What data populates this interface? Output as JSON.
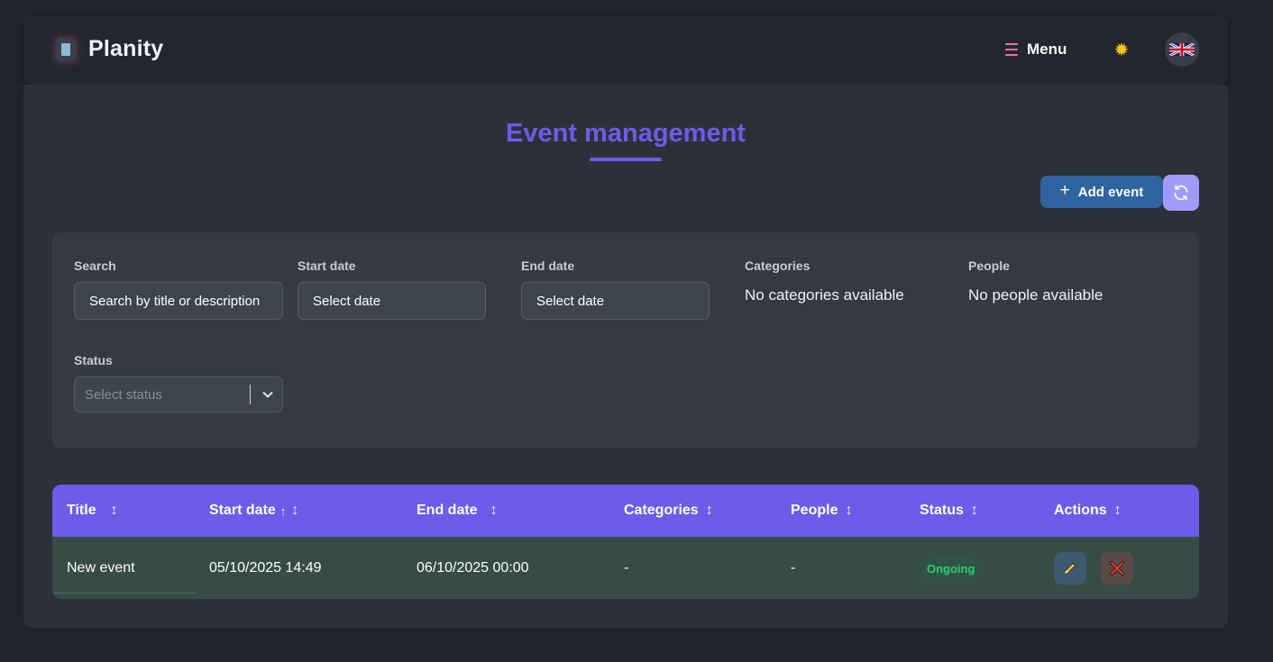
{
  "brand": {
    "name": "Planity"
  },
  "nav": {
    "menu_label": "Menu",
    "theme_icon": "sun-icon",
    "language_icon": "uk-flag-icon"
  },
  "page": {
    "title": "Event management"
  },
  "toolbar": {
    "add_label": "Add event",
    "add_icon": "plus-icon",
    "refresh_icon": "refresh-icon"
  },
  "filters": {
    "search_label": "Search",
    "search_placeholder": "Search by title or description",
    "start_label": "Start date",
    "start_placeholder": "Select date",
    "end_label": "End date",
    "end_placeholder": "Select date",
    "categories_label": "Categories",
    "categories_empty": "No categories available",
    "people_label": "People",
    "people_empty": "No people available",
    "status_label": "Status",
    "status_placeholder": "Select status"
  },
  "table": {
    "columns": [
      "Title",
      "Start date",
      "End date",
      "Categories",
      "People",
      "Status",
      "Actions"
    ],
    "sort_glyph": "↕",
    "sort_active_glyph": "↑",
    "rows": [
      {
        "title": "New event",
        "start": "05/10/2025 14:49",
        "end": "06/10/2025 00:00",
        "categories": "-",
        "people": "-",
        "status": "Ongoing"
      }
    ]
  },
  "colors": {
    "accent": "#6c5ce7",
    "primary_button": "#2f64a0",
    "refresh_button": "#a29bfe",
    "status_ongoing": "#2ecc71",
    "row_background": "#374c46"
  }
}
